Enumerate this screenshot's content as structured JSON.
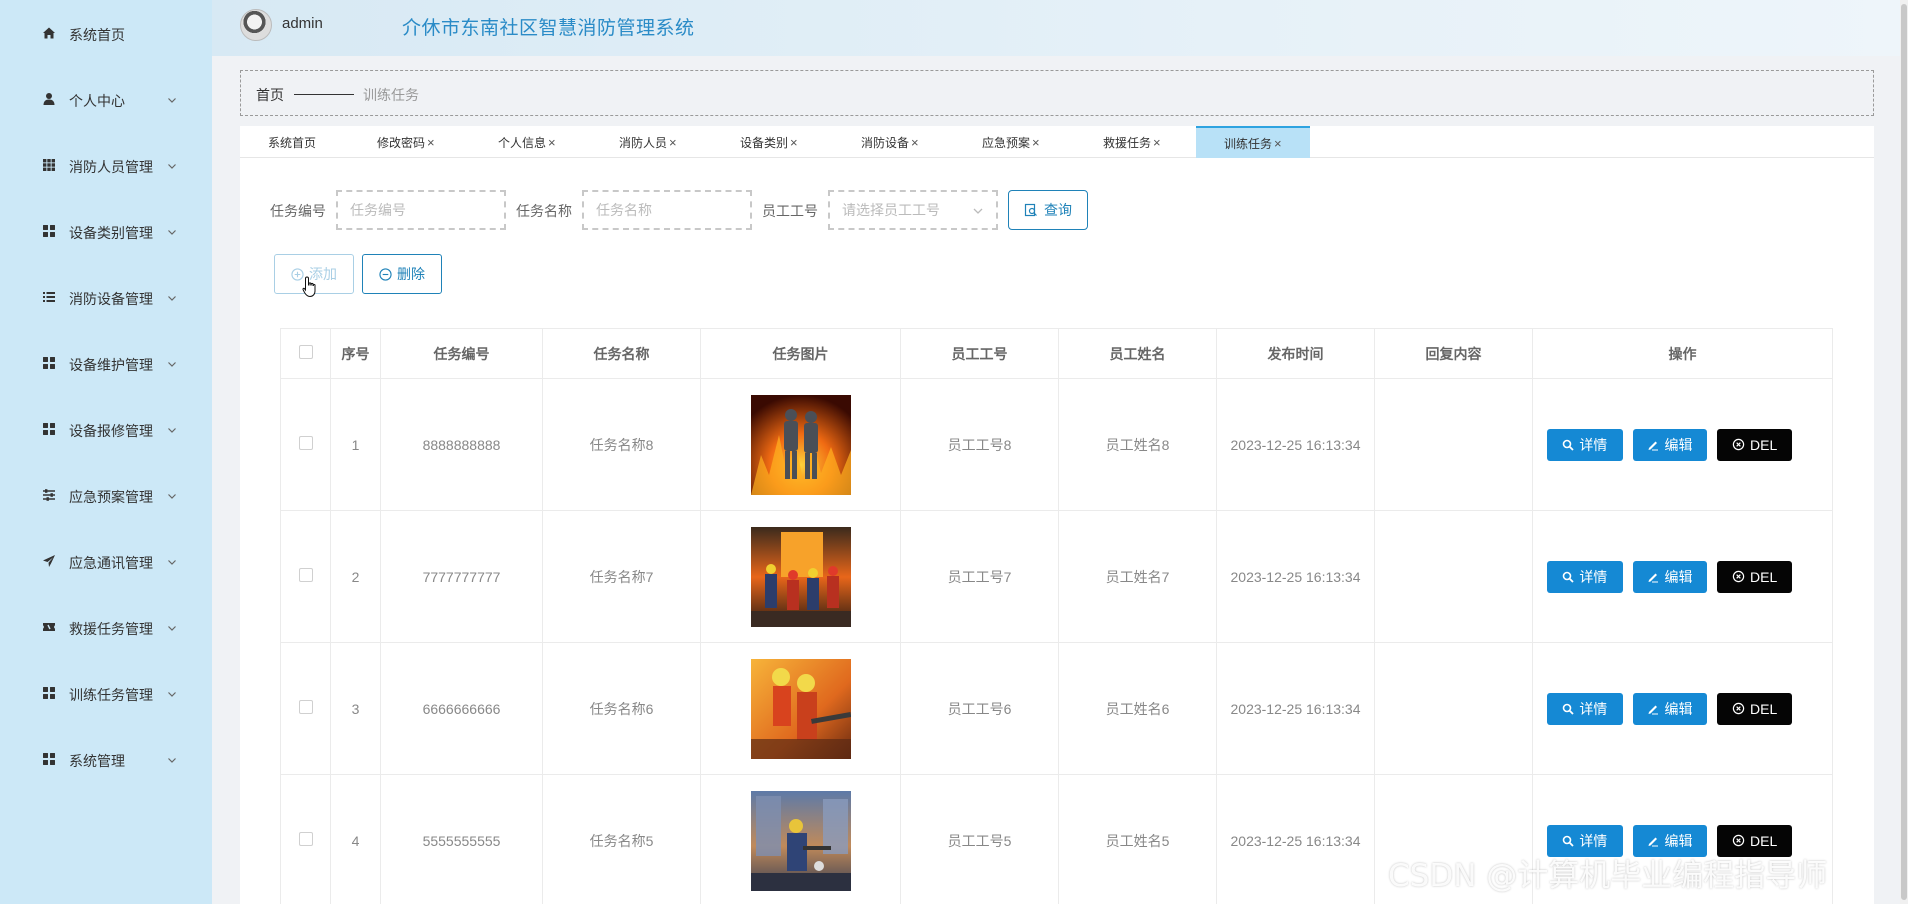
{
  "header": {
    "username": "admin",
    "title": "介休市东南社区智慧消防管理系统"
  },
  "sidebar": {
    "items": [
      {
        "label": "系统首页",
        "icon": "home-icon",
        "has_chevron": false
      },
      {
        "label": "个人中心",
        "icon": "user-icon",
        "has_chevron": true
      },
      {
        "label": "消防人员管理",
        "icon": "grid-icon",
        "has_chevron": true
      },
      {
        "label": "设备类别管理",
        "icon": "apps-icon",
        "has_chevron": true
      },
      {
        "label": "消防设备管理",
        "icon": "list-icon",
        "has_chevron": true
      },
      {
        "label": "设备维护管理",
        "icon": "apps-icon",
        "has_chevron": true
      },
      {
        "label": "设备报修管理",
        "icon": "apps-icon",
        "has_chevron": true
      },
      {
        "label": "应急预案管理",
        "icon": "sliders-icon",
        "has_chevron": true
      },
      {
        "label": "应急通讯管理",
        "icon": "send-icon",
        "has_chevron": true
      },
      {
        "label": "救援任务管理",
        "icon": "ticket-icon",
        "has_chevron": true
      },
      {
        "label": "训练任务管理",
        "icon": "apps-icon",
        "has_chevron": true
      },
      {
        "label": "系统管理",
        "icon": "apps-icon",
        "has_chevron": true
      }
    ]
  },
  "breadcrumb": {
    "home": "首页",
    "current": "训练任务"
  },
  "tabs": [
    {
      "label": "系统首页",
      "closable": false
    },
    {
      "label": "修改密码",
      "closable": true
    },
    {
      "label": "个人信息",
      "closable": true
    },
    {
      "label": "消防人员",
      "closable": true
    },
    {
      "label": "设备类别",
      "closable": true
    },
    {
      "label": "消防设备",
      "closable": true
    },
    {
      "label": "应急预案",
      "closable": true
    },
    {
      "label": "救援任务",
      "closable": true
    },
    {
      "label": "训练任务",
      "closable": true,
      "active": true
    }
  ],
  "tab_close": "×",
  "search": {
    "task_no_label": "任务编号",
    "task_no_placeholder": "任务编号",
    "task_name_label": "任务名称",
    "task_name_placeholder": "任务名称",
    "emp_no_label": "员工工号",
    "emp_no_placeholder": "请选择员工工号",
    "query_button": "查询"
  },
  "actions": {
    "add_button": "添加",
    "delete_button": "删除"
  },
  "table": {
    "columns": [
      "序号",
      "任务编号",
      "任务名称",
      "任务图片",
      "员工工号",
      "员工姓名",
      "发布时间",
      "回复内容",
      "操作"
    ],
    "rows": [
      {
        "index": "1",
        "task_no": "8888888888",
        "task_name": "任务名称8",
        "emp_no": "员工工号8",
        "emp_name": "员工姓名8",
        "time": "2023-12-25 16:13:34",
        "reply": ""
      },
      {
        "index": "2",
        "task_no": "7777777777",
        "task_name": "任务名称7",
        "emp_no": "员工工号7",
        "emp_name": "员工姓名7",
        "time": "2023-12-25 16:13:34",
        "reply": ""
      },
      {
        "index": "3",
        "task_no": "6666666666",
        "task_name": "任务名称6",
        "emp_no": "员工工号6",
        "emp_name": "员工姓名6",
        "time": "2023-12-25 16:13:34",
        "reply": ""
      },
      {
        "index": "4",
        "task_no": "5555555555",
        "task_name": "任务名称5",
        "emp_no": "员工工号5",
        "emp_name": "员工姓名5",
        "time": "2023-12-25 16:13:34",
        "reply": ""
      }
    ],
    "op_detail": "详情",
    "op_edit": "编辑",
    "op_delete": "DEL"
  },
  "watermark": "CSDN @计算机毕业编程指导师",
  "colors": {
    "sidebar_bg": "#cce8f7",
    "accent": "#1589d4",
    "title": "#2a8bc7",
    "delete_bg": "#050505",
    "active_tab": "#b8e1f7"
  }
}
